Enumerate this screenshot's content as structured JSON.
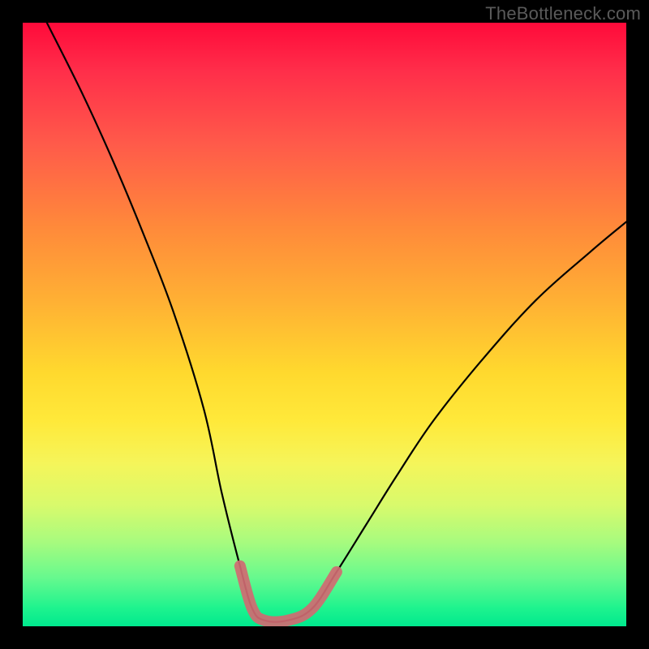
{
  "watermark": "TheBottleneck.com",
  "chart_data": {
    "type": "line",
    "title": "",
    "xlabel": "",
    "ylabel": "",
    "xlim": [
      0,
      100
    ],
    "ylim": [
      0,
      100
    ],
    "series": [
      {
        "name": "bottleneck-curve",
        "x": [
          4,
          10,
          15,
          20,
          25,
          30,
          33,
          36,
          38,
          40,
          44,
          48,
          52,
          57,
          62,
          68,
          76,
          85,
          94,
          100
        ],
        "values": [
          100,
          88,
          77,
          65,
          52,
          36,
          22,
          10,
          3,
          1,
          1,
          3,
          9,
          17,
          25,
          34,
          44,
          54,
          62,
          67
        ]
      },
      {
        "name": "bottom-highlight",
        "x": [
          36,
          38,
          40,
          44,
          48,
          52
        ],
        "values": [
          10,
          3,
          1,
          1,
          3,
          9
        ]
      }
    ],
    "gradient_stops": [
      {
        "pos": 0,
        "color": "#ff0a3a"
      },
      {
        "pos": 50,
        "color": "#ffd92e"
      },
      {
        "pos": 100,
        "color": "#00e98e"
      }
    ]
  }
}
